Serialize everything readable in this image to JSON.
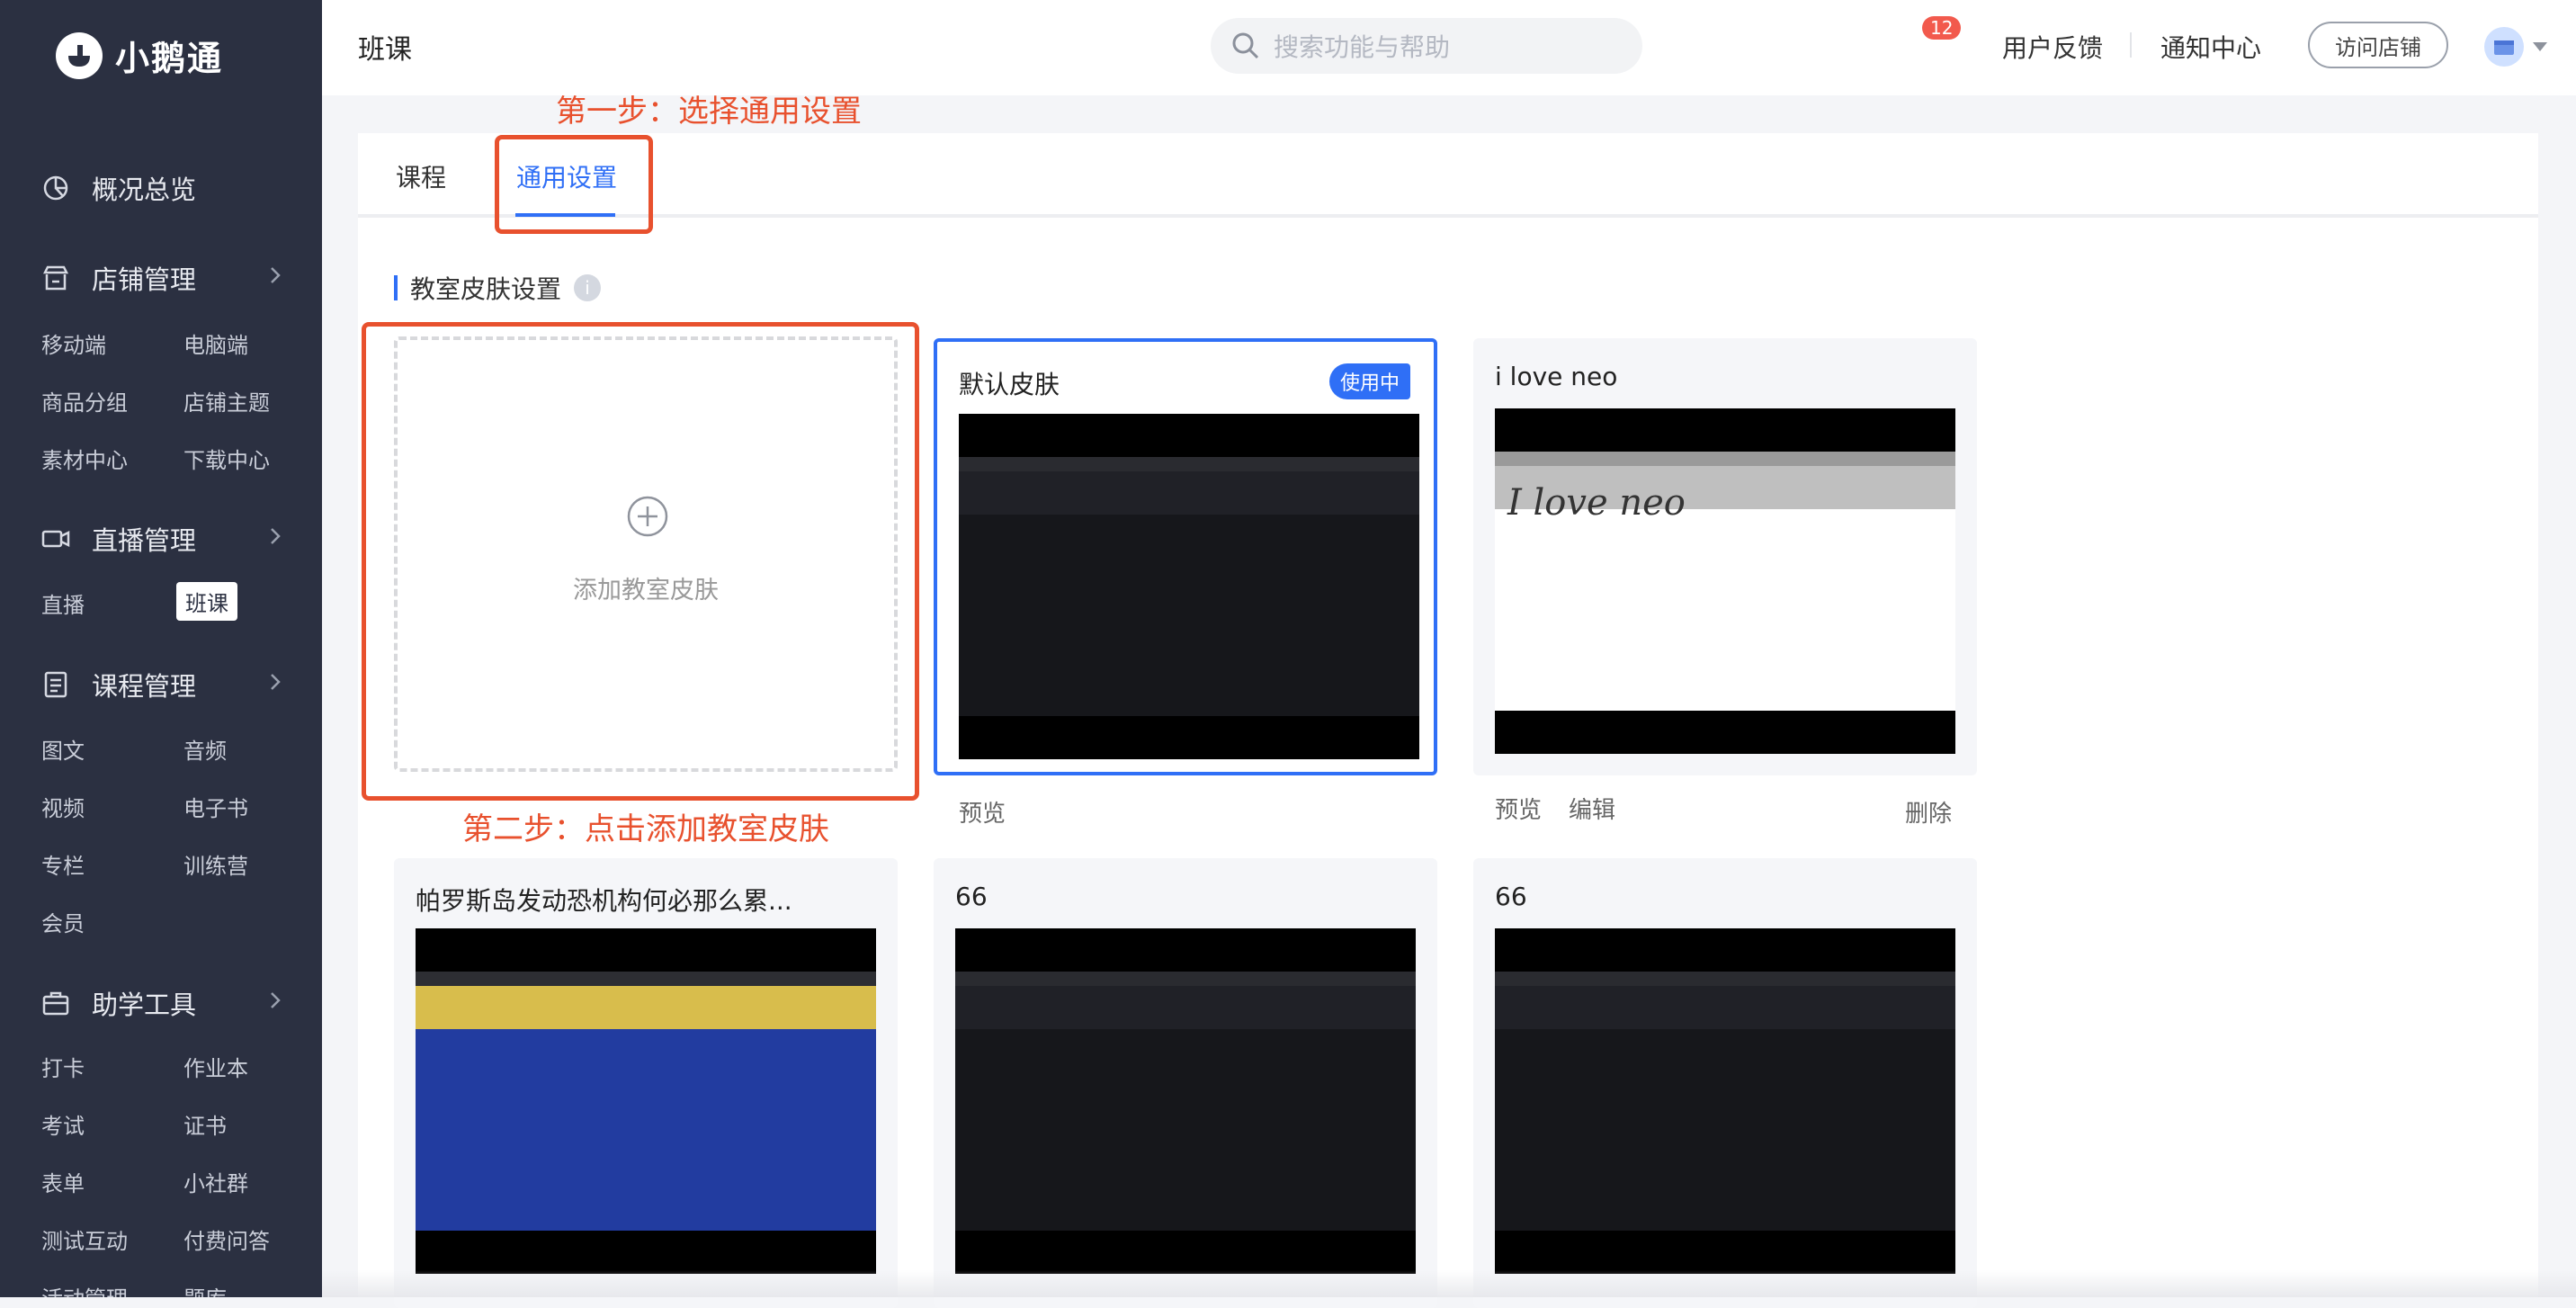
{
  "app": {
    "name": "小鹅通"
  },
  "sidebar": {
    "groups": [
      {
        "label": "概况总览",
        "icon": "pie-chart-icon",
        "items": []
      },
      {
        "label": "店铺管理",
        "icon": "store-icon",
        "items": [
          "移动端",
          "电脑端",
          "商品分组",
          "店铺主题",
          "素材中心",
          "下载中心"
        ]
      },
      {
        "label": "直播管理",
        "icon": "video-camera-icon",
        "items": [
          "直播",
          "班课"
        ]
      },
      {
        "label": "课程管理",
        "icon": "document-icon",
        "items": [
          "图文",
          "音频",
          "视频",
          "电子书",
          "专栏",
          "训练营",
          "会员"
        ]
      },
      {
        "label": "助学工具",
        "icon": "toolbox-icon",
        "items": [
          "打卡",
          "作业本",
          "考试",
          "证书",
          "表单",
          "小社群",
          "测试互动",
          "付费问答",
          "活动管理",
          "题库"
        ]
      }
    ],
    "active_item": "班课"
  },
  "header": {
    "title": "班课",
    "search_placeholder": "搜索功能与帮助",
    "feedback": "用户反馈",
    "notifications": "通知中心",
    "notification_count": "12",
    "visit_store": "访问店铺"
  },
  "tabs": [
    {
      "label": "课程",
      "active": false
    },
    {
      "label": "通用设置",
      "active": true
    }
  ],
  "section": {
    "title": "教室皮肤设置",
    "info": "i"
  },
  "add_skin": {
    "label": "添加教室皮肤"
  },
  "skins": [
    {
      "name": "默认皮肤",
      "badge": "使用中",
      "actions": [
        "预览"
      ]
    },
    {
      "name": "i love neo",
      "handwriting": "I love neo",
      "actions": [
        "预览",
        "编辑",
        "删除"
      ]
    },
    {
      "name": "帕罗斯岛发动恐机构何必那么累...",
      "actions": []
    },
    {
      "name": "66",
      "actions": []
    },
    {
      "name": "66",
      "actions": []
    }
  ],
  "annotations": {
    "step1": "第一步：选择通用设置",
    "step2": "第二步：点击添加教室皮肤"
  },
  "colors": {
    "sidebar_bg": "#2b3041",
    "accent": "#2f6ff6",
    "annotation": "#e8512e",
    "badge": "#f25a4d"
  }
}
